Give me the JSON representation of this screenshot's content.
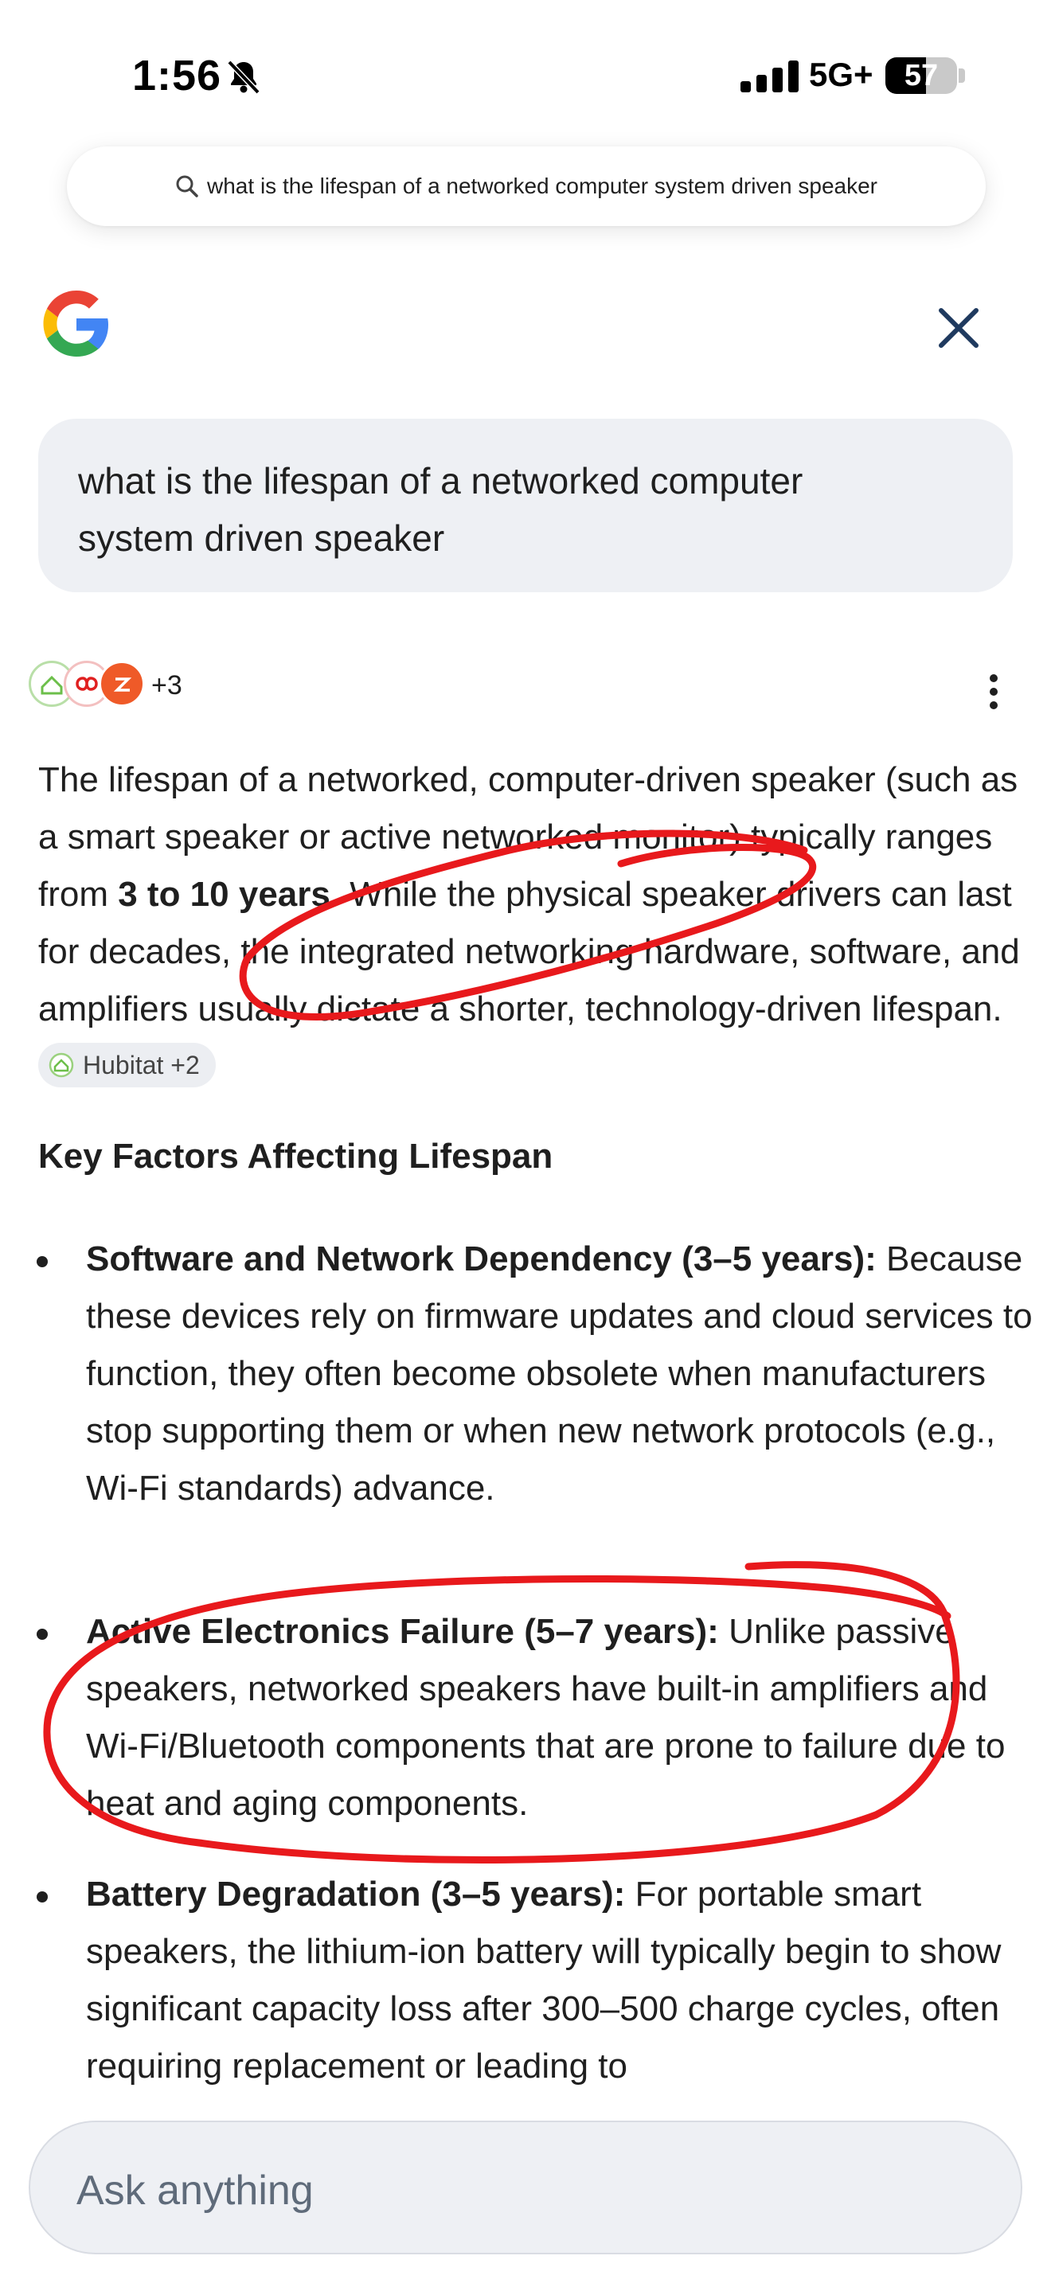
{
  "status_bar": {
    "time": "1:56",
    "network": "5G+",
    "battery": "57"
  },
  "url_bar": {
    "query": "what is the lifespan of a networked computer system driven speaker"
  },
  "query_bubble": {
    "line1": "what is the lifespan of a networked computer",
    "line2": "system driven speaker"
  },
  "sources": {
    "more": "+3"
  },
  "answer": {
    "intro_before_bold": "The lifespan of a networked, computer-driven speaker (such as a smart speaker or active networked monitor) typically ranges from ",
    "intro_bold": "3 to 10 years",
    "intro_after_bold": ". While the physical speaker drivers can last for decades, the integrated networking hardware, software, and amplifiers usually dictate a shorter, technology-driven lifespan.",
    "citation_chip": "Hubitat +2",
    "heading": "Key Factors Affecting Lifespan",
    "bullets": [
      {
        "title": "Software and Network Dependency (3–5 years):",
        "text": "Because these devices rely on firmware updates and cloud services to function, they often become obsolete when manufacturers stop supporting them or when new network protocols (e.g., Wi-Fi standards) advance."
      },
      {
        "title": "Active Electronics Failure (5–7 years):",
        "text": "Unlike passive speakers, networked speakers have built-in amplifiers and Wi-Fi/Bluetooth components that are prone to failure due to heat and aging components."
      },
      {
        "title": "Battery Degradation (3–5 years):",
        "text": "For portable smart speakers, the lithium-ion battery will typically begin to show significant capacity loss after 300–500 charge cycles, often requiring replacement or leading to"
      }
    ]
  },
  "ask_bar": {
    "placeholder": "Ask anything"
  },
  "colors": {
    "annotation_red": "#e8191c",
    "bubble_bg": "#eef0f4",
    "chip_bg": "#eceef2"
  }
}
